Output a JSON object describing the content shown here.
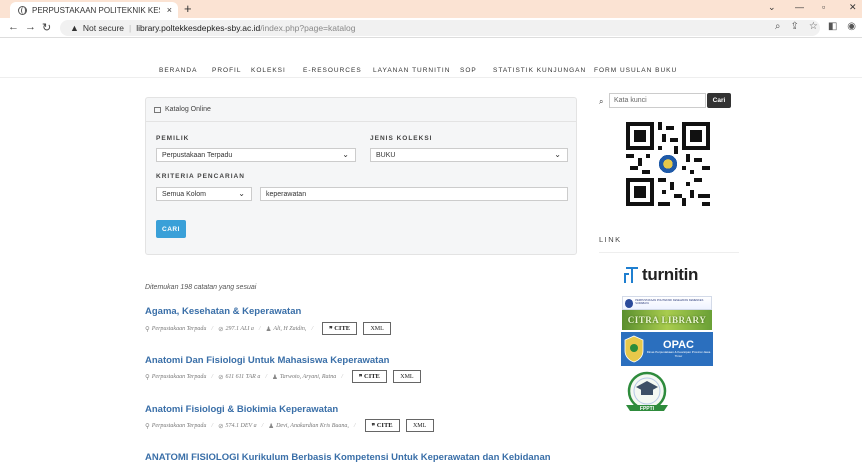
{
  "browser": {
    "tab_title": "PERPUSTAKAAN POLITEKNIK KES",
    "tab_close": "×",
    "new_tab": "+",
    "win_min": "—",
    "win_max": "▫",
    "win_close": "✕",
    "not_secure": "Not secure",
    "url_host": "library.poltekkesdepkes-sby.ac.id",
    "url_path": "/index.php?page=katalog"
  },
  "nav": {
    "items": [
      "BERANDA",
      "PROFIL",
      "KOLEKSI",
      "E-RESOURCES",
      "LAYANAN TURNITIN",
      "SOP",
      "STATISTIK KUNJUNGAN",
      "FORM USULAN BUKU"
    ]
  },
  "katalog": {
    "header": "Katalog Online",
    "pemilik_label": "PEMILIK",
    "pemilik_value": "Perpustakaan Terpadu",
    "jenis_label": "JENIS KOLEKSI",
    "jenis_value": "BUKU",
    "kriteria_label": "KRITERIA PENCARIAN",
    "kriteria_value": "Semua Kolom",
    "search_value": "keperawatan",
    "cari_button": "CARI"
  },
  "results": {
    "found_text": "Ditemukan 198 catatan yang sesuai",
    "cite_label": "CITE",
    "xml_label": "XML",
    "items": [
      {
        "title": "Agama, Kesehatan & Keperawatan",
        "owner": "Perpustakaan Terpadu",
        "call": "297.1 ALI a",
        "author": "Ali, H Zaidin,"
      },
      {
        "title": "Anatomi Dan Fisiologi Untuk Mahasiswa Keperawatan",
        "owner": "Perpustakaan Terpadu",
        "call": "611 611 TAR a",
        "author": "Tarwoto, Aryani, Ratna"
      },
      {
        "title": "Anatomi Fisiologi & Biokimia Keperawatan",
        "owner": "Perpustakaan Terpadu",
        "call": "574.1 DEV a",
        "author": "Devi, Anakardian Kris Buana,"
      },
      {
        "title": "ANATOMI FISIOLOGI Kurikulum Berbasis Kompetensi Untuk Keperawatan dan Kebidanan"
      }
    ]
  },
  "sidebar": {
    "search_placeholder": "Kata kunci",
    "search_button": "Cari",
    "link_heading": "LINK",
    "turnitin_text": "turnitin",
    "banner1_text": "PERPUSTAKAAN POLITEKNIK KESEHATAN KEMENKES SURABAYA",
    "banner2_text": "CITRA LIBRARY",
    "opac_text": "OPAC",
    "opac_sub": "Dinas Perpustakaan & Kearsipan Provinsi Jawa Timur",
    "fppti_text": "FPPTI"
  },
  "colors": {
    "accent": "#3aa0d8",
    "title_link": "#3a6fa8",
    "tabbar": "#fbe3d3"
  }
}
